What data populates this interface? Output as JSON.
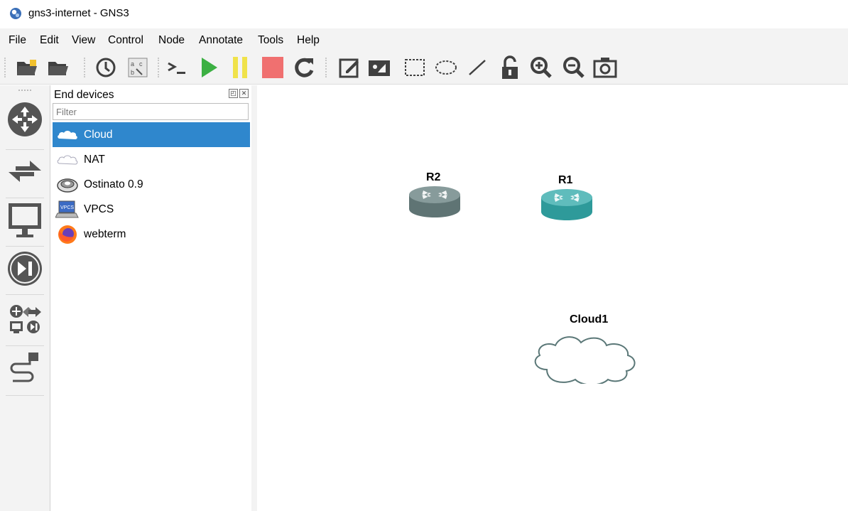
{
  "window": {
    "title": "gns3-internet - GNS3"
  },
  "menu": {
    "items": [
      "File",
      "Edit",
      "View",
      "Control",
      "Node",
      "Annotate",
      "Tools",
      "Help"
    ]
  },
  "toolbar": {
    "icons": [
      "new-project-icon",
      "open-project-icon",
      "snapshot-icon",
      "show-interface-labels-icon",
      "console-all-icon",
      "start-all-icon",
      "suspend-all-icon",
      "stop-all-icon",
      "reload-all-icon",
      "add-note-icon",
      "insert-picture-icon",
      "draw-rectangle-icon",
      "draw-ellipse-icon",
      "draw-line-icon",
      "lock-icon",
      "zoom-in-icon",
      "zoom-out-icon",
      "screenshot-icon"
    ]
  },
  "left_toolbar": {
    "icons": [
      "routers-icon",
      "switches-icon",
      "end-devices-icon",
      "security-devices-icon",
      "all-devices-icon",
      "add-link-icon"
    ]
  },
  "dock": {
    "title": "End devices",
    "filter_placeholder": "Filter",
    "devices": [
      {
        "label": "Cloud",
        "icon": "cloud-icon",
        "selected": true
      },
      {
        "label": "NAT",
        "icon": "nat-cloud-icon",
        "selected": false
      },
      {
        "label": "Ostinato 0.9",
        "icon": "ostinato-icon",
        "selected": false
      },
      {
        "label": "VPCS",
        "icon": "vpcs-icon",
        "selected": false
      },
      {
        "label": "webterm",
        "icon": "firefox-icon",
        "selected": false
      }
    ]
  },
  "topology": {
    "nodes": [
      {
        "label": "R2",
        "type": "router",
        "color": "#5f7474"
      },
      {
        "label": "R1",
        "type": "router",
        "color": "#2e9a9a"
      },
      {
        "label": "Cloud1",
        "type": "cloud",
        "color": "#5a7777"
      }
    ]
  },
  "colors": {
    "selected_row": "#2f87cd",
    "start": "#3cb043",
    "suspend": "#f0e24a",
    "stop": "#f07070"
  }
}
